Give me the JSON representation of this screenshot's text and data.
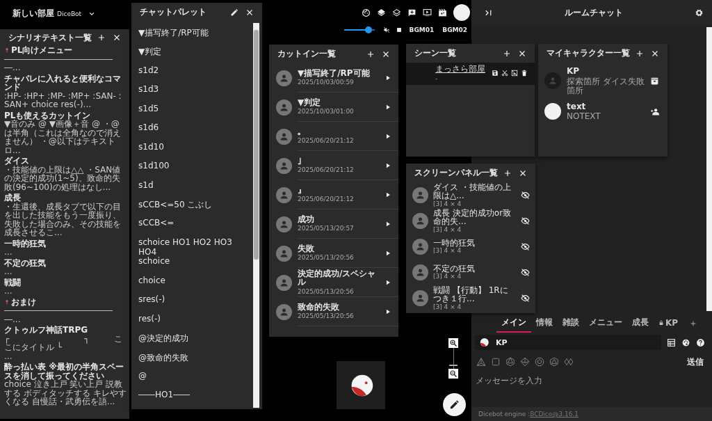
{
  "room": {
    "title": "新しい部屋",
    "system": "DiceBot"
  },
  "bgm": {
    "volume": {
      "level": 0.8
    },
    "tracks": [
      "BGM01",
      "BGM02"
    ]
  },
  "scenario_panel": {
    "title": "シナリオテキスト一覧",
    "items": [
      {
        "kind": "pinned",
        "title": "PL向けメニュー",
        "body": "――――――――――――――..."
      },
      {
        "kind": "text",
        "title": "チャパレに入れると便利なコマンド",
        "body": ":HP- :HP+ :MP- :MP+ :SAN- :SAN+ choice res(-)..."
      },
      {
        "kind": "text",
        "title": "PLも使えるカットイン",
        "body": "▼音のみ @ ▼画像＋音 @ ・@は半角（これは全角なので消えません） ・@以下はテキストロ..."
      },
      {
        "kind": "text",
        "title": "ダイス",
        "body": "・技能値の上限は△△ ・SAN値の決定的成功(1~5)、致命的失敗(96~100)の処理はなし..."
      },
      {
        "kind": "text",
        "title": "成長",
        "body": "・生還後、成長タブで以下の目を出した技能をもう一度振り、失敗した場合のみ、その技能を成長させるこ..."
      },
      {
        "kind": "text",
        "title": "一時的狂気",
        "body": "..."
      },
      {
        "kind": "text",
        "title": "不定の狂気",
        "body": "..."
      },
      {
        "kind": "text",
        "title": "戦闘",
        "body": "..."
      },
      {
        "kind": "pinned",
        "title": "おまけ",
        "body": "――――――――――――――..."
      },
      {
        "kind": "text",
        "title": "クトゥルフ神話TRPG",
        "body": "┌　　　　　　　　　┐　　　ここにタイトル └　　　　　　　　　　..."
      },
      {
        "kind": "text",
        "title": "酔っ払い表 ※最初の半角スペースを消して振ってください",
        "body": "choice 泣き上戸 笑い上戸 説教する ボディタッチする キレやすくなる 自慢話・武勇伝を語..."
      }
    ]
  },
  "chat_palette": {
    "title": "チャットパレット",
    "items": [
      "▼描写終了/RP可能",
      "▼判定",
      "s1d2",
      "s1d3",
      "s1d5",
      "s1d6",
      "s1d10",
      "s1d100",
      "s1d",
      "sCCB<=50 こぶし",
      "sCCB<=",
      "schoice HO1 HO2 HO3 HO4",
      "schoice",
      "choice",
      "sres(-)",
      "res(-)",
      "@決定的成功",
      "@致命的失敗",
      "@",
      "――HO1――"
    ]
  },
  "cutin_panel": {
    "title": "カットイン一覧",
    "items": [
      {
        "name": "▼描写終了/RP可能",
        "date": "2025/10/03/00:59"
      },
      {
        "name": "▼判定",
        "date": "2025/10/03/01:00"
      },
      {
        "name": "｡",
        "date": "2025/06/20/21:12"
      },
      {
        "name": "｣",
        "date": "2025/06/20/21:12"
      },
      {
        "name": "』",
        "date": "2025/06/20/21:12"
      },
      {
        "name": "成功",
        "date": "2025/05/13/20:57"
      },
      {
        "name": "失敗",
        "date": "2025/05/13/20:56"
      },
      {
        "name": "決定的成功/スペシャル",
        "date": "2025/05/13/20:56"
      },
      {
        "name": "致命的失敗",
        "date": "2025/05/13/20:56"
      }
    ]
  },
  "scene_panel": {
    "title": "シーン一覧",
    "items": [
      {
        "name": "まっさら部屋",
        "note": "-",
        "selected": true
      }
    ]
  },
  "character_panel": {
    "title": "マイキャラクター一覧",
    "items": [
      {
        "name": "KP",
        "note": "探索箇所 ダイス失敗箇所",
        "kind": "dark"
      },
      {
        "name": "text",
        "note": "NOTEXT",
        "kind": "light"
      }
    ]
  },
  "screen_panel": {
    "title": "スクリーンパネル一覧",
    "items": [
      {
        "name": "ダイス ・技能値の上限は△...",
        "info": "[3] 4 × 4",
        "hidden": true
      },
      {
        "name": "成長 決定的成功or致命的失...",
        "info": "[3] 4 × 4",
        "hidden": true
      },
      {
        "name": "一時的狂気",
        "info": "[3] 4 × 4",
        "hidden": true
      },
      {
        "name": "不定の狂気",
        "info": "[3] 4 × 4",
        "hidden": true
      },
      {
        "name": "戦闘 【行動】 1Rにつき１行...",
        "info": "[3] 4 × 4",
        "hidden": true
      }
    ]
  },
  "zoom": {
    "level": 0.15
  },
  "room_chat": {
    "title": "ルームチャット",
    "tabs": [
      {
        "label": "メイン",
        "selected": true,
        "locked": false
      },
      {
        "label": "情報",
        "selected": false,
        "locked": false
      },
      {
        "label": "雑談",
        "selected": false,
        "locked": false
      },
      {
        "label": "メニュー",
        "selected": false,
        "locked": false
      },
      {
        "label": "成長",
        "selected": false,
        "locked": false
      },
      {
        "label": "KP",
        "selected": false,
        "locked": true
      }
    ],
    "character": "KP",
    "send": "送信",
    "placeholder": "メッセージを入力",
    "footer": {
      "label": "Dicebot engine : ",
      "link": "BCDice@3.16.1"
    }
  }
}
